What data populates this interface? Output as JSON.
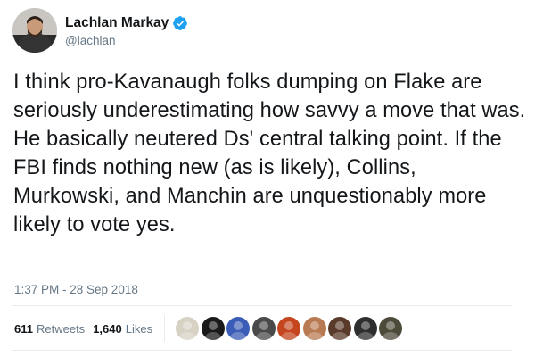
{
  "author": {
    "display_name": "Lachlan Markay",
    "handle": "@lachlan",
    "verified_icon": "verified-badge-icon",
    "badge_color": "#1da1f2"
  },
  "tweet": {
    "text": "I think pro-Kavanaugh folks dumping on Flake are seriously underestimating how savvy a move that was. He basically neutered Ds' central talking point. If the FBI finds nothing new (as is likely), Collins, Murkowski, and Manchin are unquestionably more likely to vote yes.",
    "timestamp": "1:37 PM - 28 Sep 2018"
  },
  "stats": {
    "retweets_count": "611",
    "retweets_label": "Retweets",
    "likes_count": "1,640",
    "likes_label": "Likes"
  },
  "likers": [
    {
      "name": "liker-avatar-1",
      "color": "#d8d2c4"
    },
    {
      "name": "liker-avatar-2",
      "color": "#1a1a1a"
    },
    {
      "name": "liker-avatar-3",
      "color": "#3b5db7"
    },
    {
      "name": "liker-avatar-4",
      "color": "#4a4a4a"
    },
    {
      "name": "liker-avatar-5",
      "color": "#c4451e"
    },
    {
      "name": "liker-avatar-6",
      "color": "#b87a52"
    },
    {
      "name": "liker-avatar-7",
      "color": "#5a3a2a"
    },
    {
      "name": "liker-avatar-8",
      "color": "#2e2e2e"
    },
    {
      "name": "liker-avatar-9",
      "color": "#4d4a3a"
    }
  ],
  "colors": {
    "text": "#14171a",
    "secondary": "#657786",
    "divider": "#e6ecf0"
  }
}
